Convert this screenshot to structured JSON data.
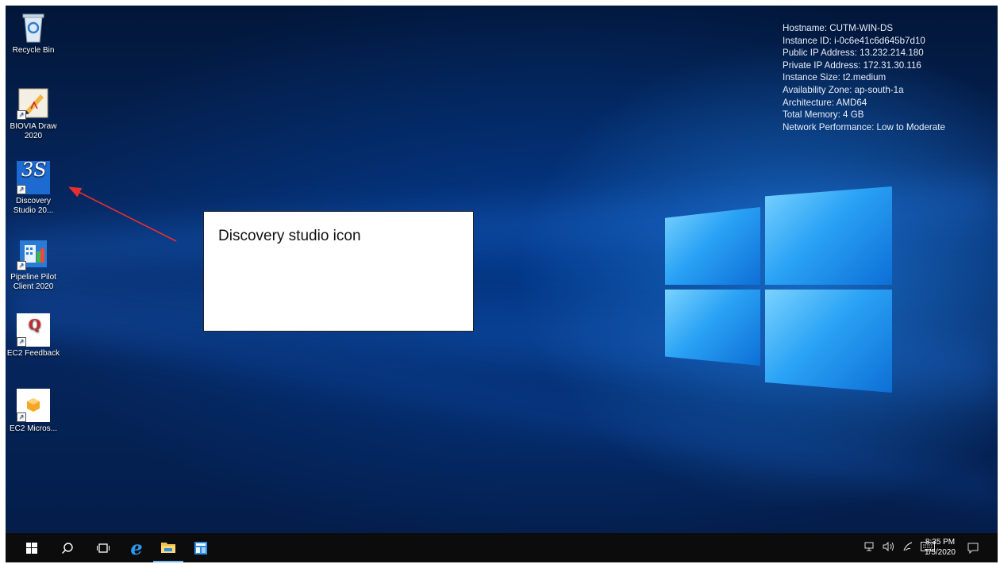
{
  "desktop": {
    "icons": [
      {
        "label": "Recycle Bin",
        "icon": "recycle-bin-icon"
      },
      {
        "label": "BIOVIA Draw 2020",
        "icon": "biovia-draw-icon"
      },
      {
        "label": "Discovery Studio 20...",
        "icon": "discovery-studio-icon",
        "glyph": "3S"
      },
      {
        "label": "Pipeline Pilot Client 2020",
        "icon": "pipeline-pilot-icon"
      },
      {
        "label": "EC2 Feedback",
        "icon": "ec2-feedback-icon",
        "glyph": "Q"
      },
      {
        "label": "EC2 Micros...",
        "icon": "ec2-microsoft-icon"
      }
    ]
  },
  "sysinfo": {
    "hostname": "Hostname: CUTM-WIN-DS",
    "instance_id": "Instance ID: i-0c6e41c6d645b7d10",
    "public_ip": "Public IP Address: 13.232.214.180",
    "private_ip": "Private IP Address: 172.31.30.116",
    "instance_size": "Instance Size: t2.medium",
    "availability_zone": "Availability Zone: ap-south-1a",
    "architecture": "Architecture: AMD64",
    "total_memory": "Total Memory: 4 GB",
    "network_performance": "Network Performance: Low to Moderate"
  },
  "annotation": {
    "callout_text": "Discovery studio icon",
    "arrow_color": "#e53030"
  },
  "taskbar": {
    "start": "windows-start-icon",
    "search": "search-icon",
    "task_view": "task-view-icon",
    "edge": "internet-explorer-icon",
    "explorer": "file-explorer-icon",
    "server_manager": "server-manager-icon",
    "tray": {
      "network": "network-icon",
      "volume": "volume-icon",
      "pen": "pen-icon",
      "keyboard": "keyboard-icon",
      "notifications": "notifications-icon"
    },
    "clock": {
      "time": "8:35 PM",
      "date": "1/5/2020"
    }
  },
  "colors": {
    "wallpaper_dark": "#021638",
    "wallpaper_light": "#2aa2f5",
    "taskbar": "#0c0c0c",
    "accent": "#0d6fd6"
  }
}
